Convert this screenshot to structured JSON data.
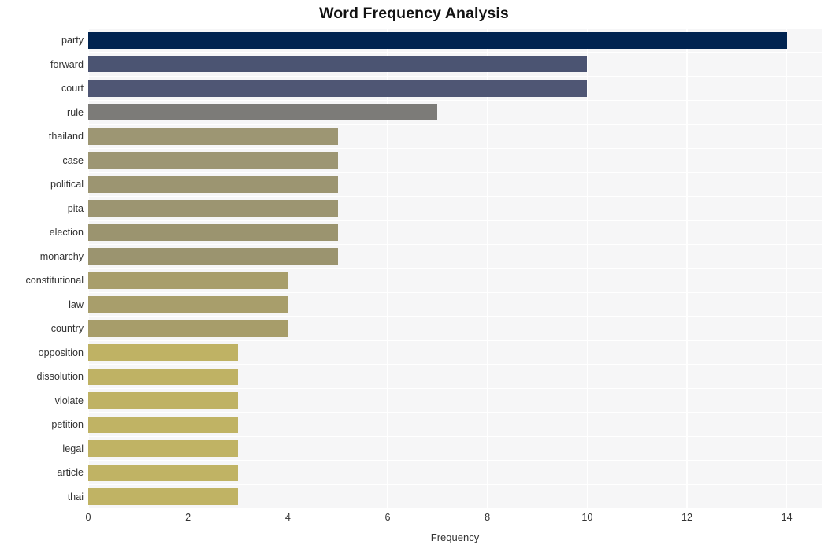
{
  "chart_data": {
    "type": "bar",
    "orientation": "horizontal",
    "title": "Word Frequency Analysis",
    "xlabel": "Frequency",
    "ylabel": "",
    "xlim": [
      0,
      14.7
    ],
    "ylim": null,
    "grid": true,
    "legend": null,
    "xticks": [
      0,
      2,
      4,
      6,
      8,
      10,
      12,
      14
    ],
    "xtick_labels": [
      "0",
      "2",
      "4",
      "6",
      "8",
      "10",
      "12",
      "14"
    ],
    "categories": [
      "party",
      "forward",
      "court",
      "rule",
      "thailand",
      "case",
      "political",
      "pita",
      "election",
      "monarchy",
      "constitutional",
      "law",
      "country",
      "opposition",
      "dissolution",
      "violate",
      "petition",
      "legal",
      "article",
      "thai"
    ],
    "values": [
      14,
      10,
      10,
      7,
      5,
      5,
      5,
      5,
      5,
      5,
      4,
      4,
      4,
      3,
      3,
      3,
      3,
      3,
      3,
      3
    ],
    "bar_colors": [
      "#002350",
      "#4b5472",
      "#4f5674",
      "#7c7b78",
      "#9d9673",
      "#9d9673",
      "#9c9571",
      "#9c9571",
      "#9b946f",
      "#9b946f",
      "#a89e6b",
      "#a89e6b",
      "#a79d6a",
      "#bfb264",
      "#bfb264",
      "#bfb264",
      "#c0b364",
      "#c0b364",
      "#c0b364",
      "#c0b364"
    ]
  },
  "style": {
    "plot_background": "#f6f6f7",
    "figure_background": "#ffffff",
    "gridline_color": "#ffffff",
    "tick_label_color": "#333333",
    "title_color": "#121212"
  }
}
